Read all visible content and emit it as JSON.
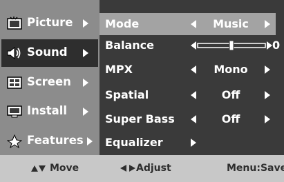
{
  "sidebar": {
    "items": [
      {
        "label": "Picture",
        "icon": "picture-icon",
        "active": false
      },
      {
        "label": "Sound",
        "icon": "sound-icon",
        "active": true
      },
      {
        "label": "Screen",
        "icon": "screen-icon",
        "active": false
      },
      {
        "label": "Install",
        "icon": "install-icon",
        "active": false
      },
      {
        "label": "Features",
        "icon": "features-icon",
        "active": false
      }
    ]
  },
  "menu": {
    "rows": [
      {
        "label": "Mode",
        "value": "Music",
        "selected": true
      },
      {
        "label": "Balance",
        "value": "0",
        "balance_level": 0
      },
      {
        "label": "MPX",
        "value": "Mono"
      },
      {
        "label": "Spatial",
        "value": "Off"
      },
      {
        "label": "Super Bass",
        "value": "Off"
      },
      {
        "label": "Equalizer",
        "value": ""
      }
    ]
  },
  "footer": {
    "move": "Move",
    "adjust": "Adjust",
    "save": "Menu:Save"
  },
  "colors": {
    "sidebar_bg": "#8c8c8c",
    "sidebar_active": "#2e2e2e",
    "panel_bg": "#3a3a3a",
    "selected_row": "#a3a3a3",
    "footer_bg": "#c8c8c8"
  }
}
